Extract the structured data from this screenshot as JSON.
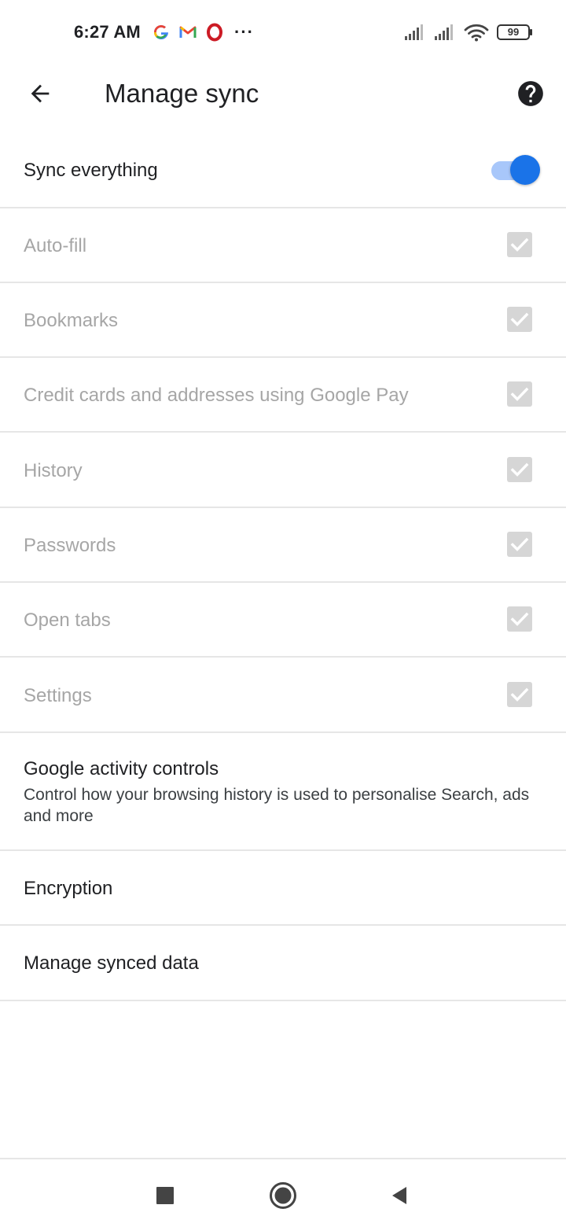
{
  "status_bar": {
    "time": "6:27 AM",
    "notification_icons": [
      "google-g-icon",
      "gmail-icon",
      "opera-icon"
    ],
    "more_indicator": "···",
    "battery_level": "99",
    "right_icons": [
      "cell-signal-icon",
      "cell-signal-icon",
      "wifi-icon",
      "battery-icon"
    ]
  },
  "app_bar": {
    "title": "Manage sync",
    "back_icon": "arrow-back-icon",
    "help_icon": "help-circle-icon"
  },
  "sync_everything": {
    "label": "Sync everything",
    "enabled": true,
    "accent_color": "#1a73e8"
  },
  "sync_items": [
    {
      "label": "Auto-fill",
      "checked": true,
      "disabled": true
    },
    {
      "label": "Bookmarks",
      "checked": true,
      "disabled": true
    },
    {
      "label": "Credit cards and addresses using Google Pay",
      "checked": true,
      "disabled": true
    },
    {
      "label": "History",
      "checked": true,
      "disabled": true
    },
    {
      "label": "Passwords",
      "checked": true,
      "disabled": true
    },
    {
      "label": "Open tabs",
      "checked": true,
      "disabled": true
    },
    {
      "label": "Settings",
      "checked": true,
      "disabled": true
    }
  ],
  "activity_controls": {
    "title": "Google activity controls",
    "subtitle": "Control how your browsing history is used to personalise Search, ads and more"
  },
  "encryption": {
    "label": "Encryption"
  },
  "manage_synced_data": {
    "label": "Manage synced data"
  },
  "nav_bar": {
    "icons": [
      "recents-square-icon",
      "home-circle-icon",
      "back-triangle-icon"
    ]
  }
}
